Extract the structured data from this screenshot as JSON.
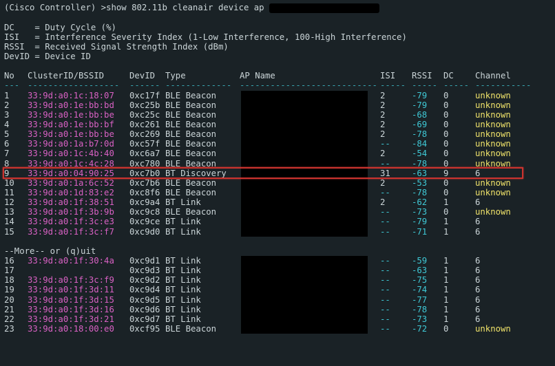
{
  "prompt": "(Cisco Controller) >",
  "command": "show 802.11b cleanair device ap ",
  "legend": [
    "DC    = Duty Cycle (%)",
    "ISI   = Interference Severity Index (1-Low Interference, 100-High Interference)",
    "RSSI  = Received Signal Strength Index (dBm)",
    "DevID = Device ID"
  ],
  "headers": {
    "no": "No",
    "bssid": "ClusterID/BSSID",
    "devid": "DevID",
    "type": "Type",
    "ap": "AP Name",
    "isi": "ISI",
    "rssi": "RSSI",
    "dc": "DC",
    "chan": "Channel"
  },
  "more_prompt": "--More-- or (q)uit",
  "highlight_row_index": 8,
  "rows": [
    {
      "no": "1",
      "bssid": "33:9d:a0:1c:18:07",
      "devid": "0xc17f",
      "type": "BLE Beacon",
      "isi": "2",
      "rssi": "-79",
      "dc": "0",
      "chan": "unknown",
      "ap_redacted": true
    },
    {
      "no": "2",
      "bssid": "33:9d:a0:1e:bb:bd",
      "devid": "0xc25b",
      "type": "BLE Beacon",
      "isi": "2",
      "rssi": "-79",
      "dc": "0",
      "chan": "unknown",
      "ap_redacted": true
    },
    {
      "no": "3",
      "bssid": "33:9d:a0:1e:bb:be",
      "devid": "0xc25c",
      "type": "BLE Beacon",
      "isi": "2",
      "rssi": "-68",
      "dc": "0",
      "chan": "unknown",
      "ap_redacted": true
    },
    {
      "no": "4",
      "bssid": "33:9d:a0:1e:bb:bf",
      "devid": "0xc261",
      "type": "BLE Beacon",
      "isi": "2",
      "rssi": "-69",
      "dc": "0",
      "chan": "unknown",
      "ap_redacted": true
    },
    {
      "no": "5",
      "bssid": "33:9d:a0:1e:bb:be",
      "devid": "0xc269",
      "type": "BLE Beacon",
      "isi": "2",
      "rssi": "-78",
      "dc": "0",
      "chan": "unknown",
      "ap_redacted": true
    },
    {
      "no": "6",
      "bssid": "33:9d:a0:1a:b7:0d",
      "devid": "0xc57f",
      "type": "BLE Beacon",
      "isi": "--",
      "rssi": "-84",
      "dc": "0",
      "chan": "unknown",
      "ap_redacted": true
    },
    {
      "no": "7",
      "bssid": "33:9d:a0:1c:4b:40",
      "devid": "0xc6a7",
      "type": "BLE Beacon",
      "isi": "2",
      "rssi": "-54",
      "dc": "0",
      "chan": "unknown",
      "ap_redacted": true
    },
    {
      "no": "8",
      "bssid": "33:9d:a0:1c:4c:28",
      "devid": "0xc780",
      "type": "BLE Beacon",
      "isi": "--",
      "rssi": "-78",
      "dc": "0",
      "chan": "unknown",
      "ap_redacted": true
    },
    {
      "no": "9",
      "bssid": "33:9d:a0:04:90:25",
      "devid": "0xc7b0",
      "type": "BT Discovery",
      "isi": "31",
      "rssi": "-63",
      "dc": "9",
      "chan": "6",
      "ap_redacted": true
    },
    {
      "no": "10",
      "bssid": "33:9d:a0:1a:6c:52",
      "devid": "0xc7b6",
      "type": "BLE Beacon",
      "isi": "2",
      "rssi": "-53",
      "dc": "0",
      "chan": "unknown",
      "ap_redacted": true
    },
    {
      "no": "11",
      "bssid": "33:9d:a0:1d:83:e2",
      "devid": "0xc8f6",
      "type": "BLE Beacon",
      "isi": "--",
      "rssi": "-78",
      "dc": "0",
      "chan": "unknown",
      "ap_redacted": true
    },
    {
      "no": "12",
      "bssid": "33:9d:a0:1f:38:51",
      "devid": "0xc9a4",
      "type": "BT Link",
      "isi": "2",
      "rssi": "-62",
      "dc": "1",
      "chan": "6",
      "ap_redacted": true
    },
    {
      "no": "13",
      "bssid": "33:9d:a0:1f:3b:9b",
      "devid": "0xc9c8",
      "type": "BLE Beacon",
      "isi": "--",
      "rssi": "-73",
      "dc": "0",
      "chan": "unknown",
      "ap_redacted": true
    },
    {
      "no": "14",
      "bssid": "33:9d:a0:1f:3c:e3",
      "devid": "0xc9ce",
      "type": "BT Link",
      "isi": "--",
      "rssi": "-79",
      "dc": "1",
      "chan": "6",
      "ap_redacted": true
    },
    {
      "no": "15",
      "bssid": "33:9d:a0:1f:3c:f7",
      "devid": "0xc9d0",
      "type": "BT Link",
      "isi": "--",
      "rssi": "-71",
      "dc": "1",
      "chan": "6",
      "ap_redacted": true
    }
  ],
  "rows2": [
    {
      "no": "16",
      "bssid": "33:9d:a0:1f:30:4a",
      "devid": "0xc9d1",
      "type": "BT Link",
      "isi": "--",
      "rssi": "-59",
      "dc": "1",
      "chan": "6",
      "ap_redacted": true
    },
    {
      "no": "17",
      "bssid": "",
      "devid": "0xc9d3",
      "type": "BT Link",
      "isi": "--",
      "rssi": "-63",
      "dc": "1",
      "chan": "6",
      "ap_redacted": true
    },
    {
      "no": "18",
      "bssid": "33:9d:a0:1f:3c:f9",
      "devid": "0xc9d2",
      "type": "BT Link",
      "isi": "--",
      "rssi": "-75",
      "dc": "1",
      "chan": "6",
      "ap_redacted": true
    },
    {
      "no": "19",
      "bssid": "33:9d:a0:1f:3d:11",
      "devid": "0xc9d4",
      "type": "BT Link",
      "isi": "--",
      "rssi": "-74",
      "dc": "1",
      "chan": "6",
      "ap_redacted": true
    },
    {
      "no": "20",
      "bssid": "33:9d:a0:1f:3d:15",
      "devid": "0xc9d5",
      "type": "BT Link",
      "isi": "--",
      "rssi": "-77",
      "dc": "1",
      "chan": "6",
      "ap_redacted": true
    },
    {
      "no": "21",
      "bssid": "33:9d:a0:1f:3d:16",
      "devid": "0xc9d6",
      "type": "BT Link",
      "isi": "--",
      "rssi": "-78",
      "dc": "1",
      "chan": "6",
      "ap_redacted": true
    },
    {
      "no": "22",
      "bssid": "33:9d:a0:1f:3d:21",
      "devid": "0xc9d7",
      "type": "BT Link",
      "isi": "--",
      "rssi": "-73",
      "dc": "1",
      "chan": "6",
      "ap_redacted": true
    },
    {
      "no": "23",
      "bssid": "33:9d:a0:18:00:e0",
      "devid": "0xcf95",
      "type": "BLE Beacon",
      "isi": "--",
      "rssi": "-72",
      "dc": "0",
      "chan": "unknown",
      "ap_redacted": true
    }
  ]
}
